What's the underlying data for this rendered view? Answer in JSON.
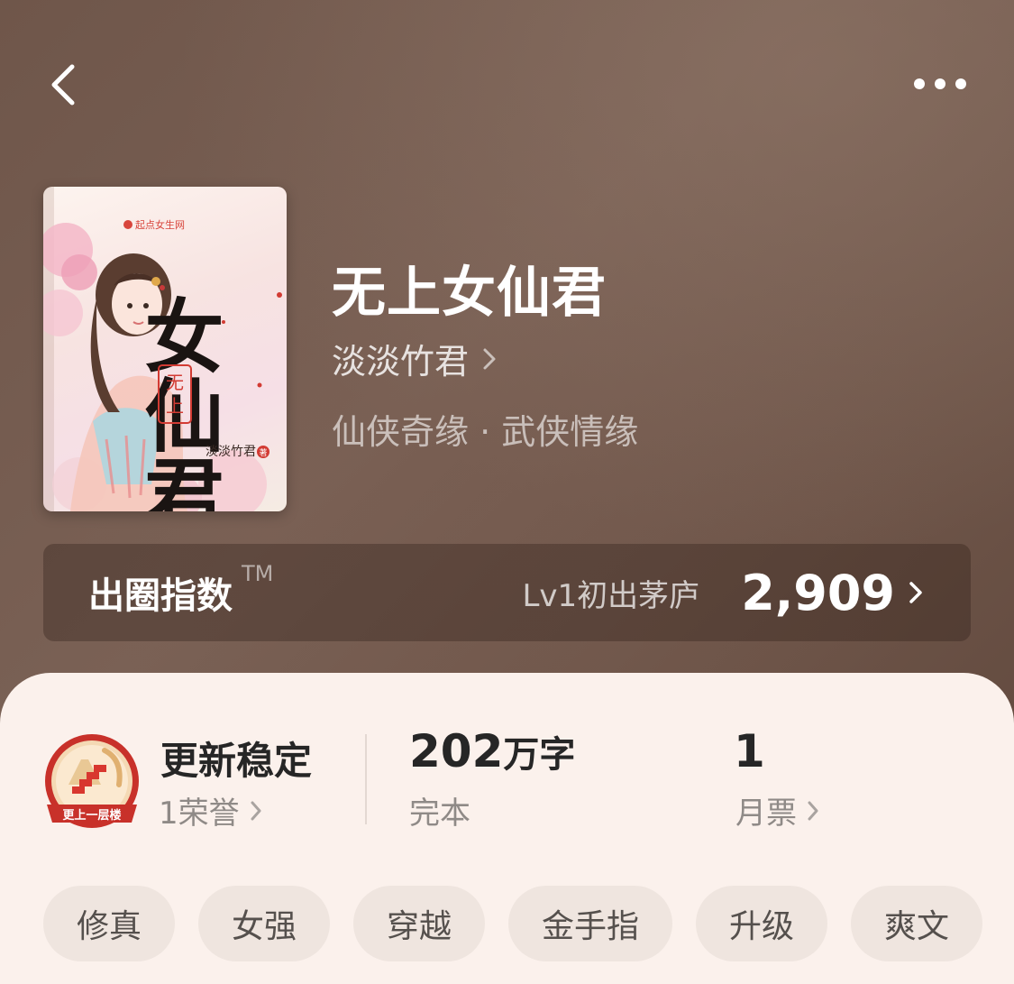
{
  "nav": {
    "back_icon": "chevron-left-icon",
    "more_icon": "more-horizontal-icon"
  },
  "cover": {
    "publisher_logo": "起点女生网",
    "title_art": "女仙君",
    "subtitle_art": "无上",
    "author_art": "淡淡竹君",
    "author_mark": "著"
  },
  "book": {
    "title": "无上女仙君",
    "author": "淡淡竹君",
    "genres": "仙侠奇缘 · 武侠情缘"
  },
  "index": {
    "label": "出圈指数",
    "tm": "TM",
    "level": "Lv1初出茅庐",
    "score": "2,909"
  },
  "stats": {
    "honor": {
      "title": "更新稳定",
      "sub": "1荣誉",
      "medal_text": "更上一层楼"
    },
    "words": {
      "number": "202",
      "unit": "万字",
      "sub": "完本"
    },
    "tickets": {
      "number": "1",
      "sub": "月票"
    }
  },
  "tags": [
    "修真",
    "女强",
    "穿越",
    "金手指",
    "升级",
    "爽文"
  ],
  "colors": {
    "header_bg": "#72594d",
    "panel_bg": "#fbf1ec",
    "tag_bg": "#efe5df",
    "medal_red": "#c8312a",
    "medal_gold": "#e0b070"
  }
}
